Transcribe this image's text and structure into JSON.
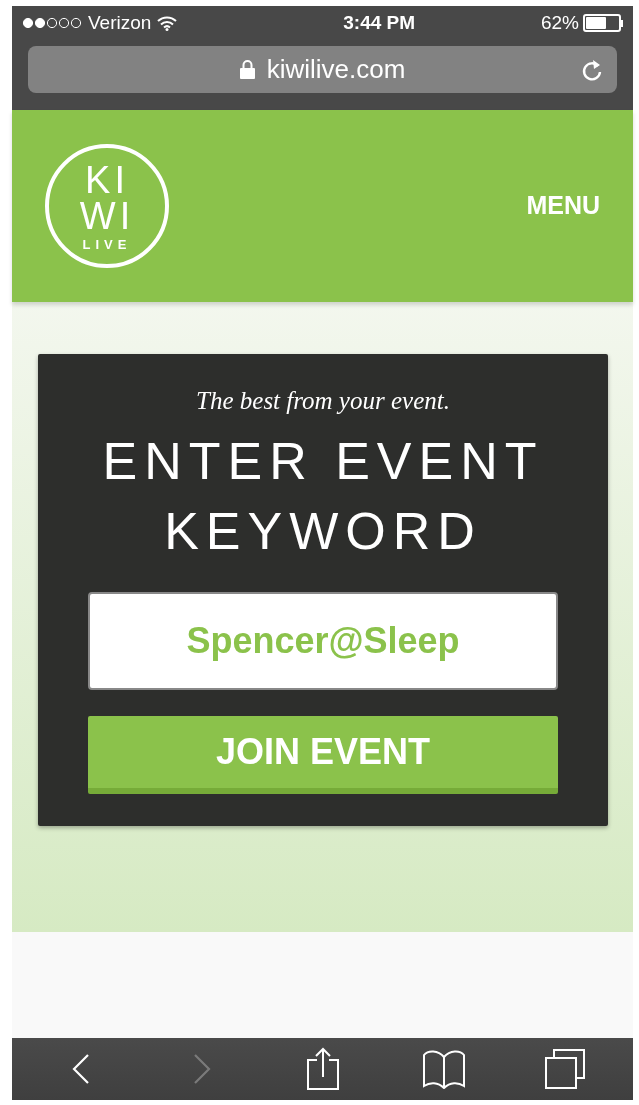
{
  "status_bar": {
    "carrier": "Verizon",
    "time": "3:44 PM",
    "battery": "62%"
  },
  "address_bar": {
    "url": "kiwilive.com"
  },
  "header": {
    "logo": [
      "KI",
      "WI",
      "LIVE"
    ],
    "menu": "MENU"
  },
  "card": {
    "tagline": "The best from your event.",
    "heading": [
      "ENTER EVENT",
      "KEYWORD"
    ],
    "keyword_field": {
      "value": "Spencer@Sleep"
    },
    "join_button": "JOIN EVENT"
  },
  "toolbar": [
    {
      "kind": "back",
      "disabled": false
    },
    {
      "kind": "forward",
      "disabled": true
    },
    {
      "kind": "share",
      "disabled": false
    },
    {
      "kind": "bookmarks",
      "disabled": false
    },
    {
      "kind": "tabs",
      "disabled": false
    }
  ]
}
